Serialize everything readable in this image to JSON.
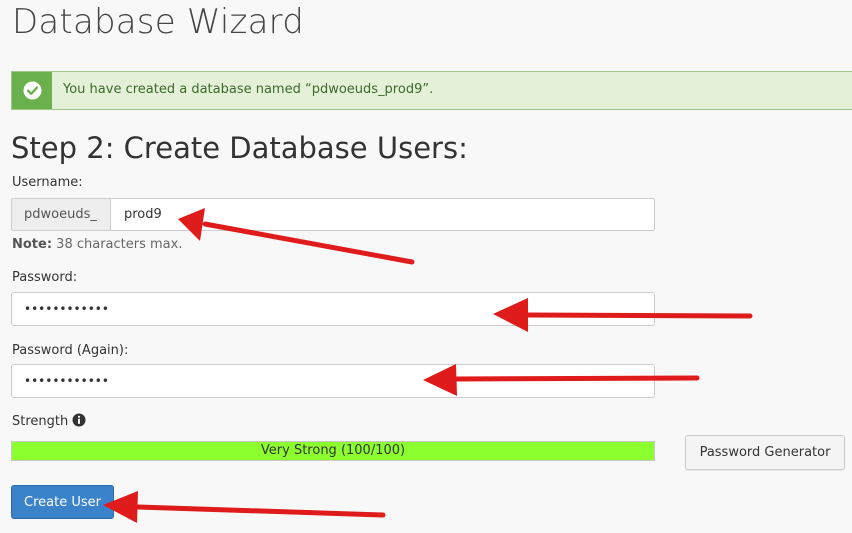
{
  "page": {
    "title": "Database Wizard"
  },
  "alert": {
    "message": "You have created a database named “pdwoeuds_prod9”.",
    "icon": "check-circle-icon",
    "color": "#6ab04c"
  },
  "step": {
    "title": "Step 2: Create Database Users:"
  },
  "username": {
    "label": "Username:",
    "prefix": "pdwoeuds_",
    "value": "prod9",
    "note_label": "Note:",
    "note_text": " 38 characters max."
  },
  "password": {
    "label": "Password:",
    "value": "••••••••••••"
  },
  "password_again": {
    "label": "Password (Again):",
    "value": "••••••••••••"
  },
  "strength": {
    "label": "Strength",
    "text": "Very Strong (100/100)",
    "score_fraction": 1.0,
    "fill_color": "#8cff2e",
    "icon": "info-circle-icon"
  },
  "buttons": {
    "password_generator": "Password Generator",
    "create_user": "Create User"
  },
  "annotation": {
    "arrow_color": "#e01b1b"
  }
}
